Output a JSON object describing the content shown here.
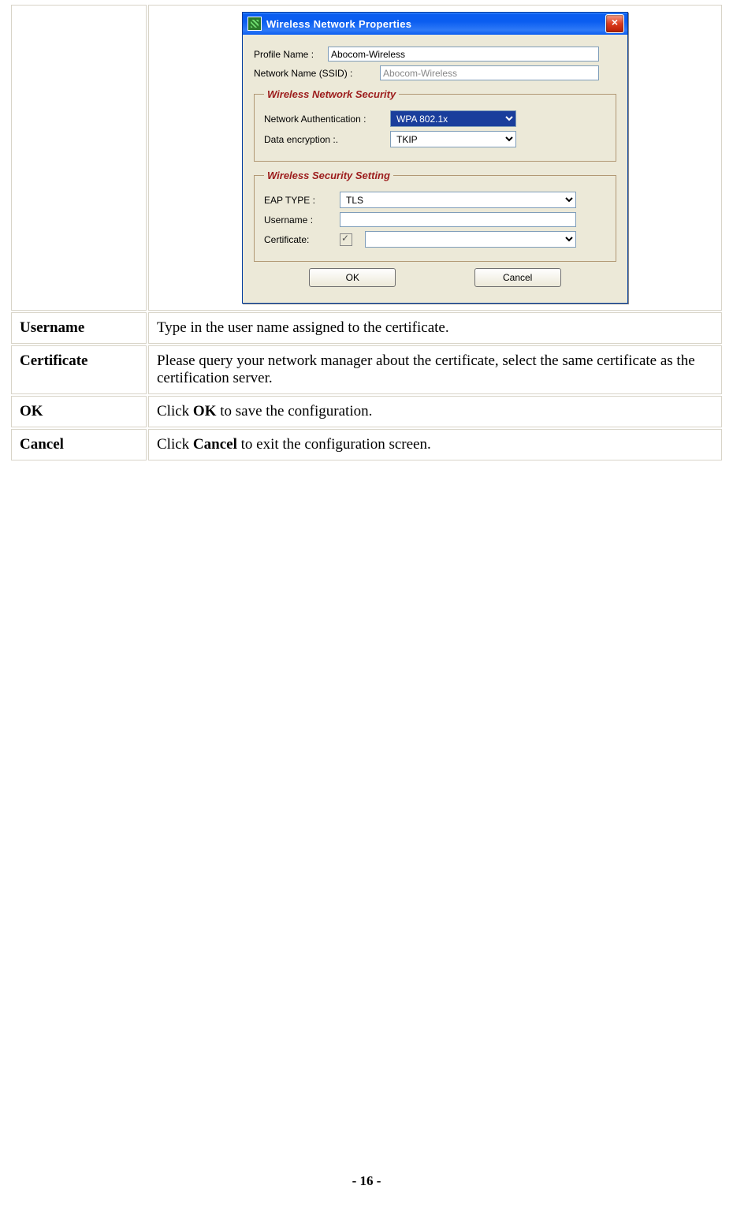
{
  "dialog": {
    "title": "Wireless Network Properties",
    "profile_name_label": "Profile Name :",
    "profile_name_value": "Abocom-Wireless",
    "ssid_label": "Network Name (SSID) :",
    "ssid_value": "Abocom-Wireless",
    "group1_legend": "Wireless Network Security",
    "net_auth_label": "Network Authentication :",
    "net_auth_value": "WPA 802.1x",
    "data_enc_label": "Data encryption :.",
    "data_enc_value": "TKIP",
    "group2_legend": "Wireless Security Setting",
    "eap_label": "EAP TYPE :",
    "eap_value": "TLS",
    "user_label": "Username :",
    "user_value": "",
    "cert_label": "Certificate:",
    "cert_value": "",
    "ok_label": "OK",
    "cancel_label": "Cancel"
  },
  "rows": {
    "username_key": "Username",
    "username_desc": "Type in the user name assigned to the certificate.",
    "cert_key": "Certificate",
    "cert_desc": "Please query your network manager about the certificate, select the same certificate as the certification server.",
    "ok_key": "OK",
    "ok_desc_pre": "Click ",
    "ok_desc_bold": "OK",
    "ok_desc_post": " to save the configuration.",
    "cancel_key": "Cancel",
    "cancel_desc_pre": "Click ",
    "cancel_desc_bold": "Cancel",
    "cancel_desc_post": " to exit the configuration screen."
  },
  "page_number": "- 16 -"
}
